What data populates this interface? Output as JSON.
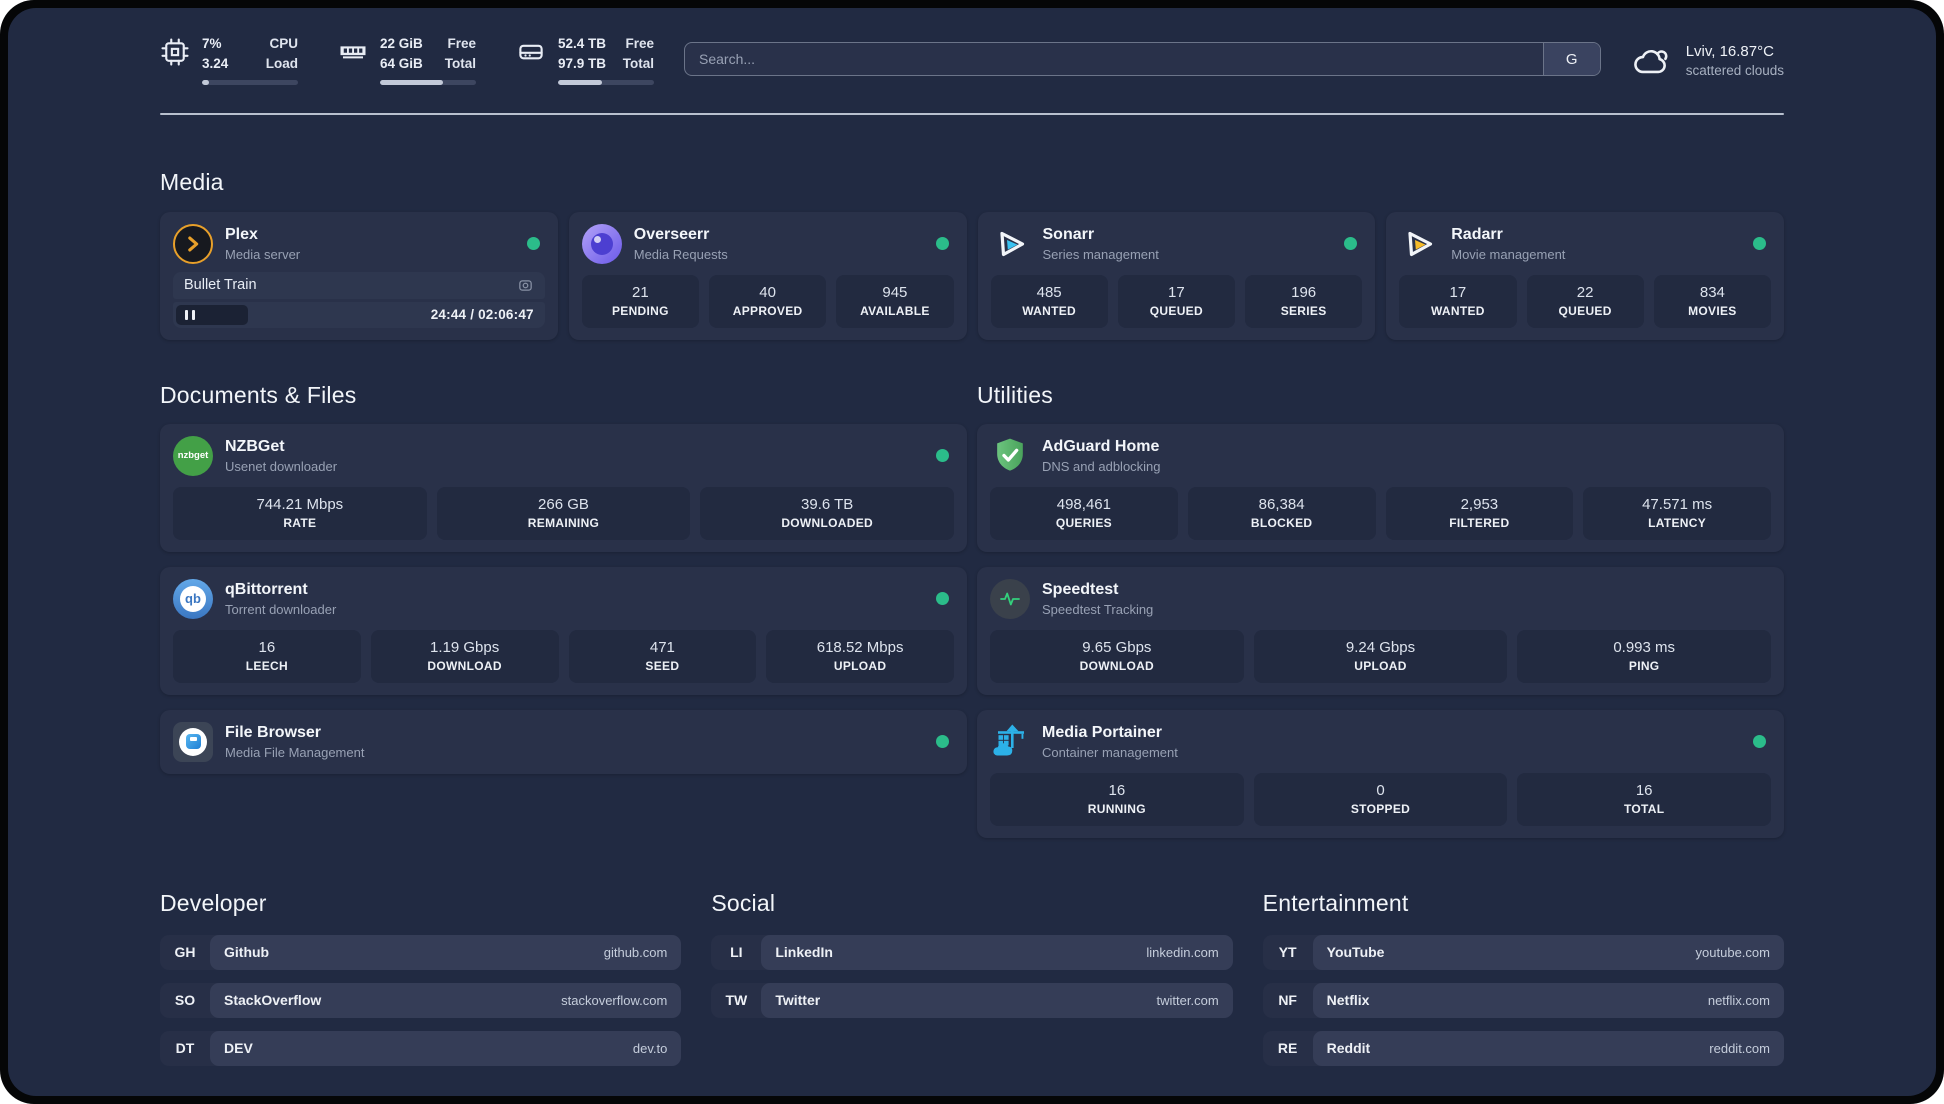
{
  "system": {
    "cpu": {
      "icon": "cpu-chip",
      "values": [
        "7%",
        "3.24"
      ],
      "labels": [
        "CPU",
        "Load"
      ],
      "percent": 7
    },
    "memory": {
      "icon": "ram-stick",
      "values": [
        "22 GiB",
        "64 GiB"
      ],
      "labels": [
        "Free",
        "Total"
      ],
      "percent": 66
    },
    "storage": {
      "icon": "hard-drive",
      "values": [
        "52.4 TB",
        "97.9 TB"
      ],
      "labels": [
        "Free",
        "Total"
      ],
      "percent": 46
    }
  },
  "search": {
    "placeholder": "Search...",
    "provider_label": "G"
  },
  "weather": {
    "icon": "cloud",
    "location": "Lviv, 16.87°C",
    "condition": "scattered clouds"
  },
  "sections": {
    "media": "Media",
    "documents": "Documents & Files",
    "utilities": "Utilities",
    "developer": "Developer",
    "social": "Social",
    "entertainment": "Entertainment"
  },
  "apps": {
    "plex": {
      "name": "Plex",
      "description": "Media server",
      "status": "online",
      "now_playing": "Bullet Train",
      "time": "24:44 / 02:06:47",
      "progress_percent": 19.5
    },
    "overseerr": {
      "name": "Overseerr",
      "description": "Media Requests",
      "status": "online",
      "stats": [
        {
          "value": "21",
          "label": "PENDING"
        },
        {
          "value": "40",
          "label": "APPROVED"
        },
        {
          "value": "945",
          "label": "AVAILABLE"
        }
      ]
    },
    "sonarr": {
      "name": "Sonarr",
      "description": "Series management",
      "status": "online",
      "stats": [
        {
          "value": "485",
          "label": "WANTED"
        },
        {
          "value": "17",
          "label": "QUEUED"
        },
        {
          "value": "196",
          "label": "SERIES"
        }
      ]
    },
    "radarr": {
      "name": "Radarr",
      "description": "Movie management",
      "status": "online",
      "stats": [
        {
          "value": "17",
          "label": "WANTED"
        },
        {
          "value": "22",
          "label": "QUEUED"
        },
        {
          "value": "834",
          "label": "MOVIES"
        }
      ]
    },
    "nzbget": {
      "name": "NZBGet",
      "description": "Usenet downloader",
      "status": "online",
      "stats": [
        {
          "value": "744.21 Mbps",
          "label": "RATE"
        },
        {
          "value": "266 GB",
          "label": "REMAINING"
        },
        {
          "value": "39.6 TB",
          "label": "DOWNLOADED"
        }
      ]
    },
    "qbittorrent": {
      "name": "qBittorrent",
      "description": "Torrent downloader",
      "status": "online",
      "stats": [
        {
          "value": "16",
          "label": "LEECH"
        },
        {
          "value": "1.19 Gbps",
          "label": "DOWNLOAD"
        },
        {
          "value": "471",
          "label": "SEED"
        },
        {
          "value": "618.52 Mbps",
          "label": "UPLOAD"
        }
      ]
    },
    "filebrowser": {
      "name": "File Browser",
      "description": "Media File Management",
      "status": "online"
    },
    "adguard": {
      "name": "AdGuard Home",
      "description": "DNS and adblocking",
      "stats": [
        {
          "value": "498,461",
          "label": "QUERIES"
        },
        {
          "value": "86,384",
          "label": "BLOCKED"
        },
        {
          "value": "2,953",
          "label": "FILTERED"
        },
        {
          "value": "47.571 ms",
          "label": "LATENCY"
        }
      ]
    },
    "speedtest": {
      "name": "Speedtest",
      "description": "Speedtest Tracking",
      "stats": [
        {
          "value": "9.65 Gbps",
          "label": "DOWNLOAD"
        },
        {
          "value": "9.24 Gbps",
          "label": "UPLOAD"
        },
        {
          "value": "0.993 ms",
          "label": "PING"
        }
      ]
    },
    "portainer": {
      "name": "Media Portainer",
      "description": "Container management",
      "status": "online",
      "stats": [
        {
          "value": "16",
          "label": "RUNNING"
        },
        {
          "value": "0",
          "label": "STOPPED"
        },
        {
          "value": "16",
          "label": "TOTAL"
        }
      ]
    }
  },
  "links": {
    "developer": [
      {
        "abbr": "GH",
        "name": "Github",
        "url": "github.com"
      },
      {
        "abbr": "SO",
        "name": "StackOverflow",
        "url": "stackoverflow.com"
      },
      {
        "abbr": "DT",
        "name": "DEV",
        "url": "dev.to"
      }
    ],
    "social": [
      {
        "abbr": "LI",
        "name": "LinkedIn",
        "url": "linkedin.com"
      },
      {
        "abbr": "TW",
        "name": "Twitter",
        "url": "twitter.com"
      }
    ],
    "entertainment": [
      {
        "abbr": "YT",
        "name": "YouTube",
        "url": "youtube.com"
      },
      {
        "abbr": "NF",
        "name": "Netflix",
        "url": "netflix.com"
      },
      {
        "abbr": "RE",
        "name": "Reddit",
        "url": "reddit.com"
      }
    ]
  },
  "colors": {
    "status_online": "#2bbc8a",
    "plex_accent": "#e8a02a",
    "sonarr_accent": "#3ac3f2",
    "radarr_accent": "#f5bb2a",
    "portainer_accent": "#2cb1e8",
    "adguard_accent": "#57b267",
    "speedtest_pulse": "#34d07c"
  }
}
